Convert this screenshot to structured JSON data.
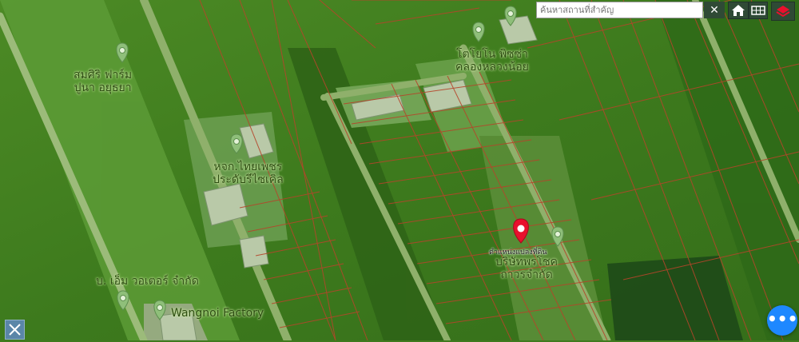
{
  "search": {
    "placeholder": "ค้นหาสถานที่สำคัญ",
    "clear_label": "✕"
  },
  "toolbar": {
    "home_icon": "home-icon",
    "grid_icon": "grid-icon",
    "layers_icon": "layers-icon"
  },
  "map": {
    "labels": {
      "somsiri_1": "สมศิริ ฟาร์ม",
      "somsiri_2": "ปูนา อยุธยา",
      "tosai_1": "โตโยโน พิซซ่า",
      "tosai_2": "คลองหลวงน้อย",
      "thai_1": "หจก.ไทยเพชร",
      "thai_2": "ประดับรีไซเคิล",
      "bp_1": "บ. เอ็ม วอเตอร์ จำกัด",
      "wangnoi": "Wangnoi Factory",
      "company_1": "บริษัทพรโชค",
      "company_2": "ถาวรจำกัด",
      "current": "ตำแหน่งแปลงที่ดิน"
    }
  },
  "fab": {
    "label": "•••"
  },
  "colors": {
    "parcel_line": "#b5452a",
    "marker": "#e8102d",
    "fab": "#1e88ff"
  }
}
